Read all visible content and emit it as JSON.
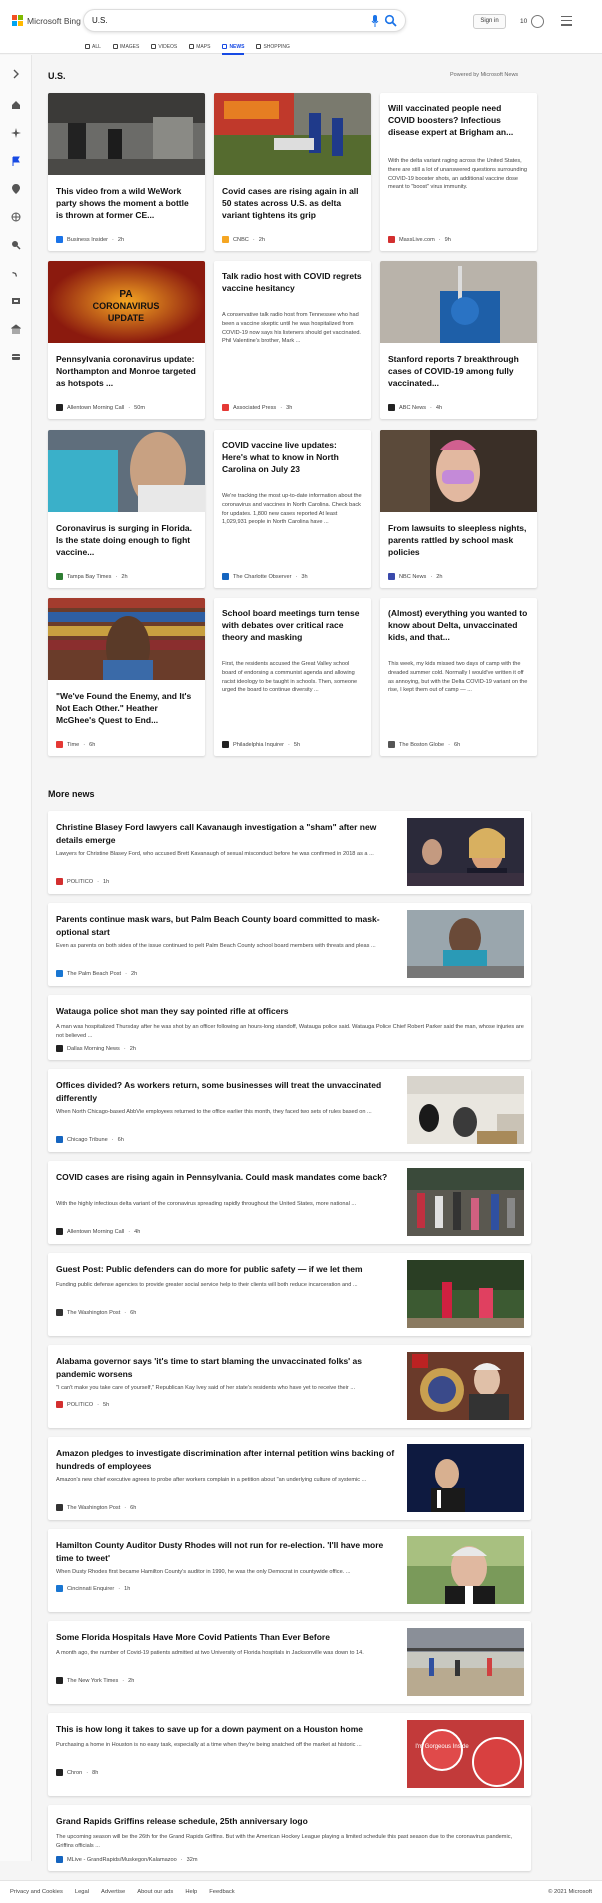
{
  "brand": {
    "name": "Microsoft Bing",
    "colors": [
      "#f25022",
      "#7fba00",
      "#00a4ef",
      "#ffb900"
    ]
  },
  "search": {
    "query": "U.S."
  },
  "header": {
    "signin": "Sign in",
    "rewards_count": "10"
  },
  "nav": [
    "ALL",
    "IMAGES",
    "VIDEOS",
    "MAPS",
    "NEWS",
    "SHOPPING"
  ],
  "section": {
    "title": "U.S.",
    "powered": "Powered by Microsoft News"
  },
  "cards": [
    {
      "title": "This video from a wild WeWork party shows the moment a bottle is thrown at former CE...",
      "source": "Business Insider",
      "time": "2h",
      "fav": "#1a73e8"
    },
    {
      "title": "Covid cases are rising again in all 50 states across U.S. as delta variant tightens its grip",
      "source": "CNBC",
      "time": "2h",
      "fav": "#f5a623"
    },
    {
      "title": "Will vaccinated people need COVID boosters? Infectious disease expert at Brigham an...",
      "snippet": "With the delta variant raging across the United States, there are still a lot of unanswered questions surrounding COVID-19 booster shots, an additional vaccine dose meant to \"boost\" virus immunity.",
      "source": "MassLive.com",
      "time": "9h",
      "fav": "#d32f2f"
    },
    {
      "title": "Pennsylvania coronavirus update: Northampton and Monroe targeted as hotspots ...",
      "source": "Allentown Morning Call",
      "time": "50m",
      "fav": "#222222",
      "img_text": "PA CORONAVIRUS UPDATE"
    },
    {
      "title": "Talk radio host with COVID regrets vaccine hesitancy",
      "snippet": "A conservative talk radio host from Tennessee who had been a vaccine skeptic until he was hospitalized from COVID-19 now says his listeners should get vaccinated. Phil Valentine's brother, Mark ...",
      "source": "Associated Press",
      "time": "3h",
      "fav": "#e53935"
    },
    {
      "title": "Stanford reports 7 breakthrough cases of COVID-19 among fully vaccinated...",
      "source": "ABC News",
      "time": "4h",
      "fav": "#222222"
    },
    {
      "title": "Coronavirus is surging in Florida. Is the state doing enough to fight vaccine...",
      "source": "Tampa Bay Times",
      "time": "2h",
      "fav": "#2e7d32"
    },
    {
      "title": "COVID vaccine live updates: Here's what to know in North Carolina on July 23",
      "snippet": "We're tracking the most up-to-date information about the coronavirus and vaccines in North Carolina. Check back for updates. 1,800 new cases reported At least 1,029,931 people in North Carolina have ...",
      "source": "The Charlotte Observer",
      "time": "3h",
      "fav": "#1565c0"
    },
    {
      "title": "From lawsuits to sleepless nights, parents rattled by school mask policies",
      "source": "NBC News",
      "time": "2h",
      "fav": "#3949ab"
    },
    {
      "title": "\"We've Found the Enemy, and It's Not Each Other.\" Heather McGhee's Quest to End...",
      "source": "Time",
      "time": "6h",
      "fav": "#e53935"
    },
    {
      "title": "School board meetings turn tense with debates over critical race theory and masking",
      "snippet": "First, the residents accused the Great Valley school board of endorsing a communist agenda and allowing racist ideology to be taught in schools. Then, someone urged the board to continue diversity ...",
      "source": "Philadelphia Inquirer",
      "time": "5h",
      "fav": "#222222"
    },
    {
      "title": "(Almost) everything you wanted to know about Delta, unvaccinated kids, and that...",
      "snippet": "This week, my kids missed two days of camp with the dreaded summer cold. Normally I would've written it off as annoying, but with the Delta COVID-19 variant on the rise, I kept them out of camp — ...",
      "source": "The Boston Globe",
      "time": "6h",
      "fav": "#555555"
    }
  ],
  "more_news": {
    "title": "More news",
    "items": [
      {
        "title": "Christine Blasey Ford lawyers call Kavanaugh investigation a \"sham\" after new details emerge",
        "snippet": "Lawyers for Christine Blasey Ford, who accused Brett Kavanaugh of sexual misconduct before he was confirmed in 2018 as a ...",
        "source": "POLITICO",
        "time": "1h",
        "fav": "#d32f2f"
      },
      {
        "title": "Parents continue mask wars, but Palm Beach County board committed to mask-optional start",
        "snippet": "Even as parents on both sides of the issue continued to pelt Palm Beach County school board members with threats and pleas ...",
        "source": "The Palm Beach Post",
        "time": "2h",
        "fav": "#1976d2"
      },
      {
        "title": "Watauga police shot man they say pointed rifle at officers",
        "snippet": "A man was hospitalized Thursday after he was shot by an officer following an hours-long standoff, Watauga police said. Watauga Police Chief Robert Parker said the man, whose injuries are not believed ...",
        "source": "Dallas Morning News",
        "time": "2h",
        "fav": "#222222"
      },
      {
        "title": "Offices divided? As workers return, some businesses will treat the unvaccinated differently",
        "snippet": "When North Chicago-based AbbVie employees returned to the office earlier this month, they faced two sets of rules based on ...",
        "source": "Chicago Tribune",
        "time": "6h",
        "fav": "#1565c0"
      },
      {
        "title": "COVID cases are rising again in Pennsylvania. Could mask mandates come back?",
        "snippet": "With the highly infectious delta variant of the coronavirus spreading rapidly throughout the United States, more national ...",
        "source": "Allentown Morning Call",
        "time": "4h",
        "fav": "#222222"
      },
      {
        "title": "Guest Post: Public defenders can do more for public safety — if we let them",
        "snippet": "Funding public defense agencies to provide greater social service help to their clients will both reduce incarceration and ...",
        "source": "The Washington Post",
        "time": "6h",
        "fav": "#333333"
      },
      {
        "title": "Alabama governor says 'it's time to start blaming the unvaccinated folks' as pandemic worsens",
        "snippet": "\"I can't make you take care of yourself,\" Republican Kay Ivey said of her state's residents who have yet to receive their ...",
        "source": "POLITICO",
        "time": "5h",
        "fav": "#d32f2f"
      },
      {
        "title": "Amazon pledges to investigate discrimination after internal petition wins backing of hundreds of employees",
        "snippet": "Amazon's new chief executive agrees to probe after workers complain in a petition about \"an underlying culture of systemic ...",
        "source": "The Washington Post",
        "time": "6h",
        "fav": "#333333"
      },
      {
        "title": "Hamilton County Auditor Dusty Rhodes will not run for re-election. 'I'll have more time to tweet'",
        "snippet": "When Dusty Rhodes first became Hamilton County's auditor in 1990, he was the only Democrat in countywide office. ...",
        "source": "Cincinnati Enquirer",
        "time": "1h",
        "fav": "#1976d2"
      },
      {
        "title": "Some Florida Hospitals Have More Covid Patients Than Ever Before",
        "snippet": "A month ago, the number of Covid-19 patients admitted at two University of Florida hospitals in Jacksonville was down to 14.",
        "source": "The New York Times",
        "time": "2h",
        "fav": "#222222"
      },
      {
        "title": "This is how long it takes to save up for a down payment on a Houston home",
        "snippet": "Purchasing a home in Houston is no easy task, especially at a time when they're being snatched off the market at historic ...",
        "source": "Chron",
        "time": "8h",
        "fav": "#222222",
        "img_text": "I'm Gorgeous Inside"
      },
      {
        "title": "Grand Rapids Griffins release schedule, 25th anniversary logo",
        "snippet": "The upcoming season will be the 26th for the Grand Rapids Griffins. But with the American Hockey League playing a limited schedule this past season due to the coronavirus pandemic, Griffins officials ...",
        "source": "MLive - GrandRapids/Muskegon/Kalamazoo",
        "time": "32m",
        "fav": "#1565c0"
      }
    ]
  },
  "footer": {
    "links": [
      "Privacy and Cookies",
      "Legal",
      "Advertise",
      "About our ads",
      "Help",
      "Feedback"
    ],
    "copyright": "© 2021 Microsoft"
  }
}
